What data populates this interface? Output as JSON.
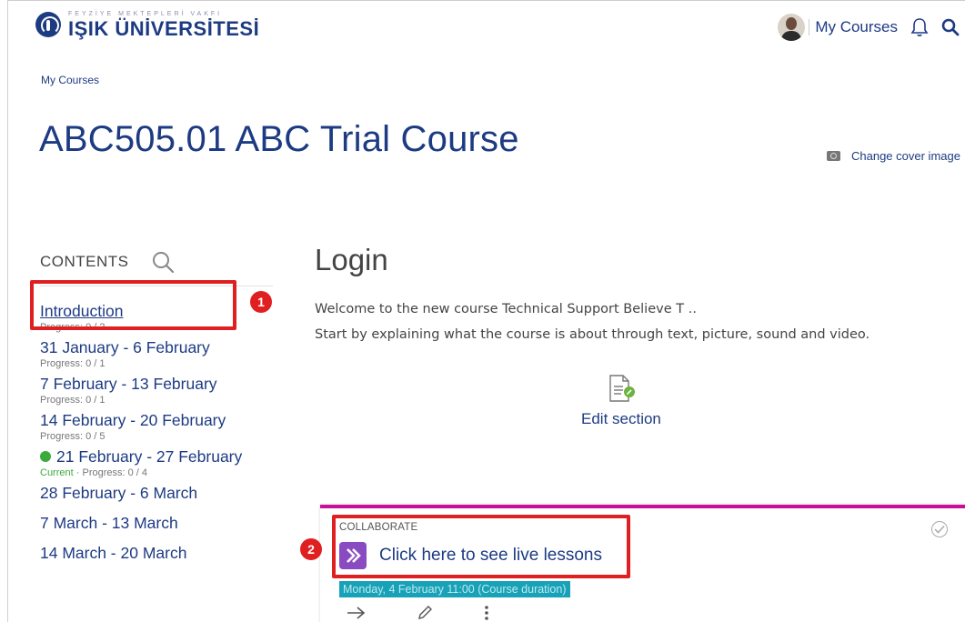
{
  "brand": {
    "tagline": "FEYZİYE MEKTEPLERİ VAKFI",
    "name": "IŞIK ÜNİVERSİTESİ",
    "color": "#1d3b83"
  },
  "topnav": {
    "my_courses": "My Courses",
    "notifications_icon": "bell-icon",
    "search_icon": "search-icon"
  },
  "breadcrumb": {
    "item": "My Courses"
  },
  "course": {
    "title": "ABC505.01 ABC Trial Course",
    "change_cover": "Change cover image"
  },
  "sidebar": {
    "title": "CONTENTS",
    "items": [
      {
        "label": "Introduction",
        "progress": "Progress: 0 / 2",
        "active": true
      },
      {
        "label": "31 January - 6 February",
        "progress": "Progress: 0 / 1"
      },
      {
        "label": "7 February - 13 February",
        "progress": "Progress: 0 / 1"
      },
      {
        "label": "14 February - 20 February",
        "progress": "Progress: 0 / 5"
      },
      {
        "label": "21 February - 27 February",
        "current": "Current",
        "progress": "Progress: 0 / 4"
      },
      {
        "label": "28 February - 6 March"
      },
      {
        "label": "7 March - 13 March"
      },
      {
        "label": "14 March - 20 March"
      }
    ],
    "current_separator": "·"
  },
  "section": {
    "title": "Login",
    "line1": "Welcome to the new course Technical Support Believe T ..",
    "line2": "Start by explaining what the course is about through text, picture, sound and video.",
    "edit_label": "Edit section"
  },
  "activity": {
    "type": "COLLABORATE",
    "name": "Click here to see live lessons",
    "date": "Monday, 4 February 11:00 (Course duration)",
    "accent_color": "#c8109a"
  },
  "callouts": {
    "one": "1",
    "two": "2",
    "color": "#e02020"
  }
}
